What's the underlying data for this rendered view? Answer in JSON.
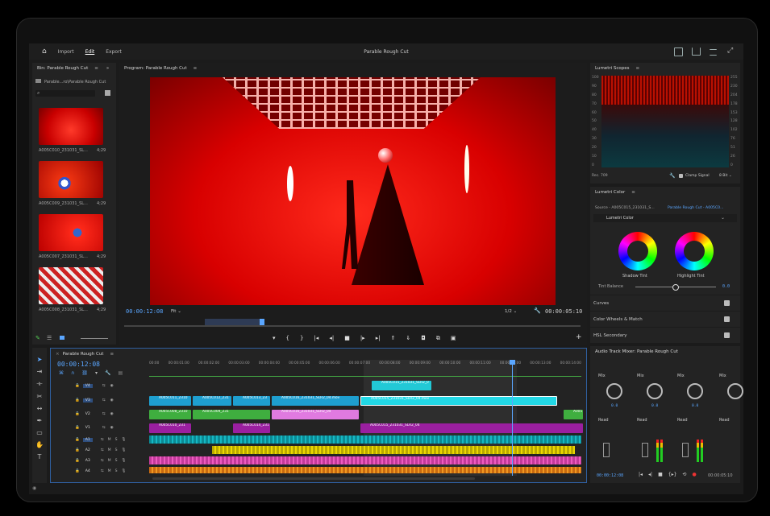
{
  "topbar": {
    "import": "Import",
    "edit": "Edit",
    "export": "Export",
    "title": "Parable Rough Cut"
  },
  "bin": {
    "tab": "Bin: Parable Rough Cut",
    "path": "Parable...ro\\Parable Rough Cut",
    "clips": [
      {
        "name": "A005C010_231031_SL...",
        "dur": "4;29"
      },
      {
        "name": "A005C009_231031_SL...",
        "dur": "4;29"
      },
      {
        "name": "A005C007_231031_SL...",
        "dur": "4;29"
      },
      {
        "name": "A005C008_231031_SL...",
        "dur": "4;29"
      }
    ]
  },
  "program": {
    "tab": "Program: Parable Rough Cut",
    "timecode": "00:00:12:08",
    "fit": "Fit",
    "res": "1/2",
    "duration": "00:00:05:10"
  },
  "scopes": {
    "tab": "Lumetri Scopes",
    "scale": [
      "100",
      "90",
      "80",
      "70",
      "60",
      "50",
      "40",
      "30",
      "20",
      "10",
      "0"
    ],
    "scale_right": [
      "255",
      "230",
      "204",
      "178",
      "153",
      "128",
      "102",
      "76",
      "51",
      "26",
      "0"
    ],
    "rec": "Rec. 709",
    "clamp": "Clamp Signal",
    "bit": "8 Bit"
  },
  "lumetri": {
    "tab": "Lumetri Color",
    "source": "Source - A005C015_231031_S...",
    "target": "Parable Rough Cut - A005C0...",
    "preset": "Lumetri Color",
    "shadow": "Shadow Tint",
    "highlight": "Highlight Tint",
    "balance": "Tint Balance",
    "balance_val": "0.0",
    "sections": [
      "Curves",
      "Color Wheels & Match",
      "HSL Secondary"
    ]
  },
  "timeline": {
    "tab": "Parable Rough Cut",
    "timecode": "00:00:12:08",
    "ruler": [
      "00:00",
      "00:00:01:00",
      "00:00:02:00",
      "00:00:03:00",
      "00:00:04:00",
      "00:00:05:00",
      "00:00:06:00",
      "00:00:07:00",
      "00:00:08:00",
      "00:00:09:00",
      "00:00:10:00",
      "00:00:11:00",
      "00:00:12:00",
      "00:00:13:00",
      "00:00:14:00"
    ],
    "tracks": [
      "V4",
      "V3",
      "V2",
      "V1",
      "A1",
      "A2",
      "A3",
      "A4"
    ],
    "clips": {
      "v4a": "A005C015_231031_SLR2_0",
      "v3a": "A005C011_2310",
      "v3b": "A005C012_231",
      "v3c": "A005C013_23",
      "v3d": "A005C016_231031_SLR2_04.mov",
      "v3e": "A005C015_231031_SLR2_04.mov",
      "v2a": "A005C008_2310",
      "v2b": "A005C009_231",
      "v2c": "A005C016_231031_SLR2_04",
      "v2d": "A005",
      "v1a": "A005C010_231",
      "v1b": "A005C014_231",
      "v1c": "A005C015_231031_SLR2_04"
    }
  },
  "mixer": {
    "tab": "Audio Track Mixer: Parable Rough Cut",
    "mix": "Mix",
    "read": "Read",
    "val": "0.0",
    "timecode": "00:00:12:08",
    "end": "00:00:05:10"
  }
}
